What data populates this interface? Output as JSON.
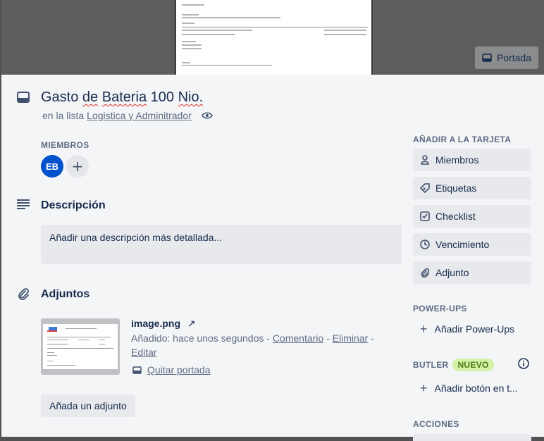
{
  "cover": {
    "button_label": "Portada",
    "doc_texts": [
      "Beneficiario",
      "Comentario",
      "Fecha Cobro: Gastos por Carga y Revision de Bateria 100 Nio...",
      "Detalle",
      "Cuenta",
      "Resumen",
      "Firma"
    ]
  },
  "card": {
    "title_word1": "Gasto",
    "title_word2": "de",
    "title_word3": "Bateria",
    "title_word4": "100",
    "title_word5": "Nio.",
    "in_list_prefix": "en la lista",
    "list_name": "Logistica y Adminitrador"
  },
  "members": {
    "heading": "MIEMBROS",
    "avatar_initials": "EB",
    "add_symbol": "+"
  },
  "description": {
    "heading": "Descripción",
    "placeholder": "Añadir una descripción más detallada..."
  },
  "attachments": {
    "heading": "Adjuntos",
    "file_name": "image.png",
    "added_prefix": "Añadido: hace unos segundos - ",
    "comment_link": "Comentario",
    "sep1": " - ",
    "delete_link": "Eliminar",
    "sep2": " -",
    "edit_link": "Editar",
    "remove_cover": "Quitar portada",
    "add_button": "Añada un adjunto"
  },
  "sidebar": {
    "add_heading": "AÑADIR A LA TARJETA",
    "items": [
      {
        "label": "Miembros",
        "icon": "person-icon"
      },
      {
        "label": "Etiquetas",
        "icon": "tag-icon"
      },
      {
        "label": "Checklist",
        "icon": "checklist-icon"
      },
      {
        "label": "Vencimiento",
        "icon": "clock-icon"
      },
      {
        "label": "Adjunto",
        "icon": "paperclip-icon"
      }
    ],
    "powerups_heading": "POWER-UPS",
    "add_powerups": "Añadir Power-Ups",
    "butler_heading": "BUTLER",
    "butler_badge": "NUEVO",
    "add_button": "Añadir botón en t...",
    "actions_heading": "ACCIONES"
  },
  "colors": {
    "avatar_bg": "#0052cc",
    "badge_bg": "#d3f1a7",
    "panel_bg": "#f4f5f7"
  }
}
